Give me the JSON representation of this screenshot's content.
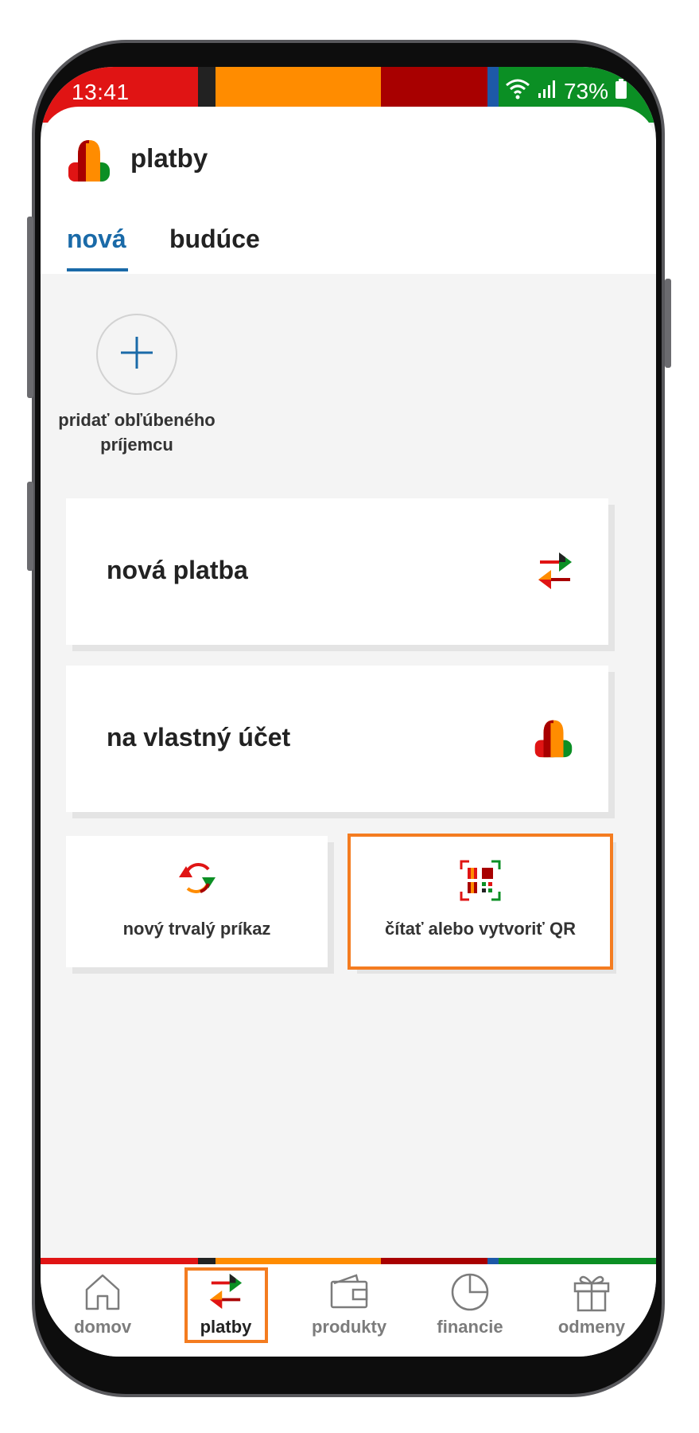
{
  "colors": {
    "accent_blue": "#1a6aa8",
    "highlight_orange": "#f47c20",
    "brand_red": "#e01414",
    "brand_orange": "#ff8c00",
    "brand_dark_red": "#a80000",
    "brand_green": "#0b8f24",
    "brand_blue": "#1d59a8",
    "brand_black": "#222222"
  },
  "status_bar": {
    "time": "13:41",
    "battery": "73%",
    "icons": [
      "wifi-icon",
      "signal-icon",
      "battery-icon"
    ]
  },
  "header": {
    "title": "platby",
    "avatar_icon": "user-avatar-icon"
  },
  "tabs": [
    {
      "label": "nová",
      "active": true
    },
    {
      "label": "budúce",
      "active": false
    }
  ],
  "favorites": {
    "add_label": "pridať obľúbeného príjemcu",
    "icon": "plus-icon"
  },
  "actions": {
    "new_payment": {
      "label": "nová platba",
      "icon": "transfer-arrows-icon"
    },
    "own_account": {
      "label": "na vlastný účet",
      "icon": "person-icon"
    },
    "standing_order": {
      "label": "nový trvalý príkaz",
      "icon": "recurring-arrows-icon"
    },
    "qr": {
      "label": "čítať alebo vytvoriť QR",
      "icon": "qr-code-icon"
    }
  },
  "bottom_nav": [
    {
      "label": "domov",
      "icon": "home-icon",
      "active": false
    },
    {
      "label": "platby",
      "icon": "transfer-arrows-icon",
      "active": true
    },
    {
      "label": "produkty",
      "icon": "wallet-icon",
      "active": false
    },
    {
      "label": "financie",
      "icon": "pie-chart-icon",
      "active": false
    },
    {
      "label": "odmeny",
      "icon": "gift-icon",
      "active": false
    }
  ]
}
